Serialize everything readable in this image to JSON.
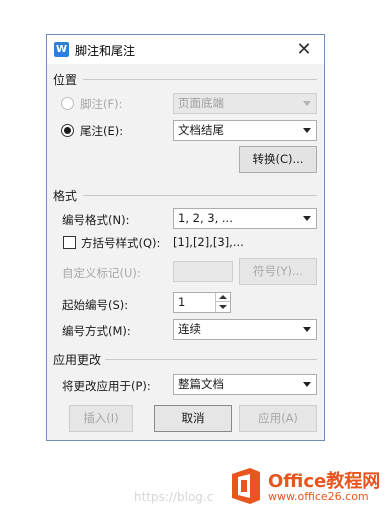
{
  "dialog": {
    "app_icon_letter": "W",
    "title": "脚注和尾注",
    "close_symbol": "✕"
  },
  "location": {
    "heading": "位置",
    "footnote": {
      "label": "脚注(F):",
      "selected": false,
      "enabled": false,
      "value": "页面底端"
    },
    "endnote": {
      "label": "尾注(E):",
      "selected": true,
      "enabled": true,
      "value": "文档结尾"
    },
    "convert_button": "转换(C)..."
  },
  "format": {
    "heading": "格式",
    "number_format": {
      "label": "编号格式(N):",
      "value": "1, 2, 3, ..."
    },
    "bracket_style": {
      "label": "方括号样式(Q):",
      "checked": false,
      "example": "[1],[2],[3],..."
    },
    "custom_mark": {
      "label": "自定义标记(U):",
      "value": "",
      "enabled": false
    },
    "symbol_button": "符号(Y)...",
    "start_at": {
      "label": "起始编号(S):",
      "value": "1"
    },
    "numbering": {
      "label": "编号方式(M):",
      "value": "连续"
    }
  },
  "apply": {
    "heading": "应用更改",
    "apply_to": {
      "label": "将更改应用于(P):",
      "value": "整篇文档"
    }
  },
  "buttons": {
    "insert": "插入(I)",
    "cancel": "取消",
    "apply": "应用(A)"
  },
  "watermark": {
    "url": "https://blog.c",
    "brand": "Office教程网",
    "site": "www.office26.com"
  }
}
